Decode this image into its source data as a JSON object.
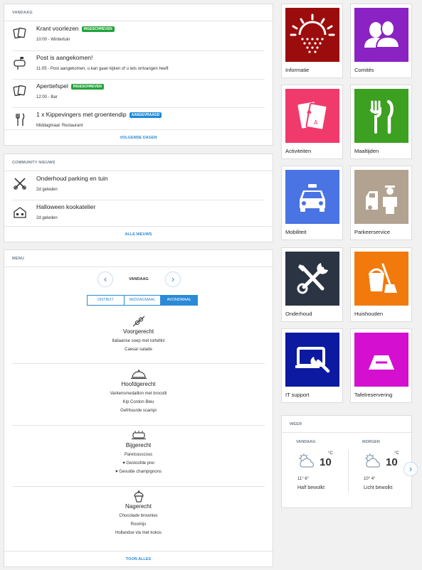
{
  "today": {
    "header": "Vandaag",
    "items": [
      {
        "title": "Krant voorlezen",
        "badge": "Ingeschreven",
        "sub": "10:00 - Wintertuin"
      },
      {
        "title": "Post is aangekomen!",
        "badge": "",
        "sub": "11:05 - Post aangekomen, u kan gaan kijken of u iets ontvangen heeft"
      },
      {
        "title": "Apertiefspel",
        "badge": "Ingeschreven",
        "sub": "12:00 - Bar"
      },
      {
        "title": "1 x Kippevingers met groentendip",
        "badge": "Aangevraagd",
        "sub": "Middagmaal: Restaurant"
      }
    ],
    "footer": "Volgende dagen"
  },
  "news": {
    "header": "Community nieuws",
    "items": [
      {
        "title": "Onderhoud parking en tuin",
        "sub": "2d geleden"
      },
      {
        "title": "Halloween kookatelier",
        "sub": "2d geleden"
      }
    ],
    "footer": "Alle nieuws"
  },
  "menu": {
    "header": "Menu",
    "day": "Vandaag",
    "tabs": [
      "Ontbijt",
      "Middagmaal",
      "Avondmaal"
    ],
    "active_tab": "Avondmaal",
    "courses": [
      {
        "title": "Voorgerecht",
        "icon": "skewer-icon",
        "items": [
          "Italiaanse soep met tortellini",
          "Caesar salade"
        ]
      },
      {
        "title": "Hoofdgerecht",
        "icon": "cloche-icon",
        "items": [
          "Varkensmedaillon met brocolli",
          "Kip Cordon Bleu",
          "Gefrituurde scampi"
        ]
      },
      {
        "title": "Bijgerecht",
        "icon": "plate-icon",
        "items": [
          "Parelcouscous",
          "♥ Gestoofde prei",
          "♥ Gevulde champignons"
        ]
      },
      {
        "title": "Nagerecht",
        "icon": "cupcake-icon",
        "items": [
          "Chocolade brownies",
          "Roomijs",
          "Hollandse vla met kokos"
        ]
      }
    ],
    "footer": "Toon alles"
  },
  "tiles": [
    {
      "label": "Informatie",
      "icon": "sun-icon",
      "color": "#9b0d0d"
    },
    {
      "label": "Comités",
      "icon": "people-icon",
      "color": "#8a22c4"
    },
    {
      "label": "Activiteiten",
      "icon": "cards-icon",
      "color": "#f13a6c"
    },
    {
      "label": "Maaltijden",
      "icon": "fork-knife-icon",
      "color": "#3ca021"
    },
    {
      "label": "Mobiliteit",
      "icon": "taxi-icon",
      "color": "#4a73e4"
    },
    {
      "label": "Parkeerservice",
      "icon": "valet-icon",
      "color": "#b2a290"
    },
    {
      "label": "Onderhoud",
      "icon": "tools-icon",
      "color": "#2a3442"
    },
    {
      "label": "Huishouden",
      "icon": "cleaning-icon",
      "color": "#f27a0c"
    },
    {
      "label": "IT support",
      "icon": "laptop-wrench-icon",
      "color": "#0b1aa0"
    },
    {
      "label": "Tafelreservering",
      "icon": "table-sign-icon",
      "color": "#d40fd0"
    }
  ],
  "weather": {
    "header": "Weer",
    "days": [
      {
        "day": "Vandaag",
        "temp": "10",
        "unit": "°C",
        "minmax": "11° 6°",
        "desc": "Half bewolkt",
        "icon": "partly-cloudy-icon"
      },
      {
        "day": "Morgen",
        "temp": "10",
        "unit": "°C",
        "minmax": "10° 4°",
        "desc": "Licht bewolkt",
        "icon": "partly-cloudy-icon"
      }
    ]
  }
}
